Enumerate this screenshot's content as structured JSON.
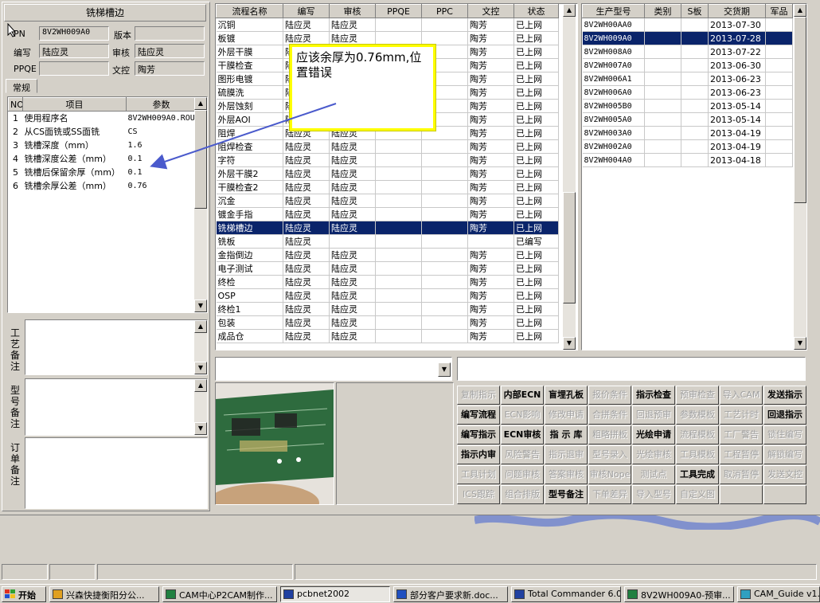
{
  "window": {
    "title": "铣梯槽边"
  },
  "info": {
    "pn_label": "PN",
    "pn_value": "8V2WH009A0",
    "version_label": "版本",
    "version_value": "",
    "writer_label": "编写",
    "writer_value": "陆应灵",
    "reviewer_label": "审核",
    "reviewer_value": "陆应灵",
    "ppqe_label": "PPQE",
    "ppqe_value": "",
    "doc_control_label": "文控",
    "doc_control_value": "陶芳"
  },
  "tabs": {
    "general": "常规"
  },
  "params_table": {
    "headers": [
      "NO",
      "项目",
      "参数"
    ],
    "rows": [
      {
        "no": "1",
        "item": "使用程序名",
        "value": "8V2WH009A0.ROU."
      },
      {
        "no": "2",
        "item": "从CS面铣或SS面铣",
        "value": "CS"
      },
      {
        "no": "3",
        "item": "铣槽深度（mm）",
        "value": "1.6"
      },
      {
        "no": "4",
        "item": "铣槽深度公差（mm）",
        "value": "0.1"
      },
      {
        "no": "5",
        "item": "铣槽后保留余厚（mm）",
        "value": "0.1"
      },
      {
        "no": "6",
        "item": "铣槽余厚公差（mm）",
        "value": "0.76"
      }
    ]
  },
  "notes": {
    "process_label": "工艺备注",
    "model_label": "型号备注",
    "order_label": "订单备注"
  },
  "flow_table": {
    "headers": [
      "流程名称",
      "编写",
      "审核",
      "PPQE",
      "PPC",
      "文控",
      "状态"
    ],
    "selected_index": 15,
    "rows": [
      [
        "沉铜",
        "陆应灵",
        "陆应灵",
        "",
        "",
        "陶芳",
        "已上网"
      ],
      [
        "板镀",
        "陆应灵",
        "陆应灵",
        "",
        "",
        "陶芳",
        "已上网"
      ],
      [
        "外层干膜",
        "陆",
        "",
        "",
        "",
        "陶芳",
        "已上网"
      ],
      [
        "干膜检查",
        "陆",
        "",
        "",
        "",
        "陶芳",
        "已上网"
      ],
      [
        "图形电镀",
        "陆",
        "",
        "",
        "",
        "陶芳",
        "已上网"
      ],
      [
        "硫膜洗",
        "陆",
        "",
        "",
        "",
        "陶芳",
        "已上网"
      ],
      [
        "外层蚀刻",
        "陆",
        "",
        "",
        "",
        "陶芳",
        "已上网"
      ],
      [
        "外层AOI",
        "陆",
        "",
        "",
        "",
        "陶芳",
        "已上网"
      ],
      [
        "阻焊",
        "陆应灵",
        "陆应灵",
        "",
        "",
        "陶芳",
        "已上网"
      ],
      [
        "阻焊检查",
        "陆应灵",
        "陆应灵",
        "",
        "",
        "陶芳",
        "已上网"
      ],
      [
        "字符",
        "陆应灵",
        "陆应灵",
        "",
        "",
        "陶芳",
        "已上网"
      ],
      [
        "外层干膜2",
        "陆应灵",
        "陆应灵",
        "",
        "",
        "陶芳",
        "已上网"
      ],
      [
        "干膜检查2",
        "陆应灵",
        "陆应灵",
        "",
        "",
        "陶芳",
        "已上网"
      ],
      [
        "沉金",
        "陆应灵",
        "陆应灵",
        "",
        "",
        "陶芳",
        "已上网"
      ],
      [
        "镀金手指",
        "陆应灵",
        "陆应灵",
        "",
        "",
        "陶芳",
        "已上网"
      ],
      [
        "铣梯槽边",
        "陆应灵",
        "陆应灵",
        "",
        "",
        "陶芳",
        "已上网"
      ],
      [
        "铣板",
        "陆应灵",
        "",
        "",
        "",
        "",
        "已编写"
      ],
      [
        "金指倒边",
        "陆应灵",
        "陆应灵",
        "",
        "",
        "陶芳",
        "已上网"
      ],
      [
        "电子测试",
        "陆应灵",
        "陆应灵",
        "",
        "",
        "陶芳",
        "已上网"
      ],
      [
        "终检",
        "陆应灵",
        "陆应灵",
        "",
        "",
        "陶芳",
        "已上网"
      ],
      [
        "OSP",
        "陆应灵",
        "陆应灵",
        "",
        "",
        "陶芳",
        "已上网"
      ],
      [
        "终检1",
        "陆应灵",
        "陆应灵",
        "",
        "",
        "陶芳",
        "已上网"
      ],
      [
        "包装",
        "陆应灵",
        "陆应灵",
        "",
        "",
        "陶芳",
        "已上网"
      ],
      [
        "成品仓",
        "陆应灵",
        "陆应灵",
        "",
        "",
        "陶芳",
        "已上网"
      ]
    ]
  },
  "annotation": {
    "text": "应该余厚为0.76mm,位置错误"
  },
  "model_table": {
    "headers": [
      "生产型号",
      "类别",
      "S板",
      "交货期",
      "军品"
    ],
    "selected_index": 1,
    "rows": [
      [
        "8V2WH00AA0",
        "",
        "",
        "2013-07-30",
        ""
      ],
      [
        "8V2WH009A0",
        "",
        "",
        "2013-07-28",
        ""
      ],
      [
        "8V2WH008A0",
        "",
        "",
        "2013-07-22",
        ""
      ],
      [
        "8V2WH007A0",
        "",
        "",
        "2013-06-30",
        ""
      ],
      [
        "8V2WH006A1",
        "",
        "",
        "2013-06-23",
        ""
      ],
      [
        "8V2WH006A0",
        "",
        "",
        "2013-06-23",
        ""
      ],
      [
        "8V2WH005B0",
        "",
        "",
        "2013-05-14",
        ""
      ],
      [
        "8V2WH005A0",
        "",
        "",
        "2013-05-14",
        ""
      ],
      [
        "8V2WH003A0",
        "",
        "",
        "2013-04-19",
        ""
      ],
      [
        "8V2WH002A0",
        "",
        "",
        "2013-04-19",
        ""
      ],
      [
        "8V2WH004A0",
        "",
        "",
        "2013-04-18",
        ""
      ]
    ]
  },
  "buttons": [
    [
      {
        "label": "复制指示",
        "enabled": false
      },
      {
        "label": "内部ECN",
        "enabled": true
      },
      {
        "label": "盲埋孔板",
        "enabled": true
      },
      {
        "label": "报价条件",
        "enabled": false
      },
      {
        "label": "指示检查",
        "enabled": true
      },
      {
        "label": "预审检查",
        "enabled": false
      },
      {
        "label": "导入CAM",
        "enabled": false
      },
      {
        "label": "发送指示",
        "enabled": true
      }
    ],
    [
      {
        "label": "编写流程",
        "enabled": true
      },
      {
        "label": "ECN影响",
        "enabled": false
      },
      {
        "label": "修改申请",
        "enabled": false
      },
      {
        "label": "合拼条件",
        "enabled": false
      },
      {
        "label": "回退预审",
        "enabled": false
      },
      {
        "label": "参数模板",
        "enabled": false
      },
      {
        "label": "工艺计时",
        "enabled": false
      },
      {
        "label": "回退指示",
        "enabled": true
      }
    ],
    [
      {
        "label": "编写指示",
        "enabled": true
      },
      {
        "label": "ECN审核",
        "enabled": true
      },
      {
        "label": "指 示 库",
        "enabled": true
      },
      {
        "label": "粗略拼板",
        "enabled": false
      },
      {
        "label": "光绘申请",
        "enabled": true
      },
      {
        "label": "流程模板",
        "enabled": false
      },
      {
        "label": "工厂警告",
        "enabled": false
      },
      {
        "label": "锁住编写",
        "enabled": false
      }
    ],
    [
      {
        "label": "指示内审",
        "enabled": true
      },
      {
        "label": "风险警告",
        "enabled": false
      },
      {
        "label": "指示退审",
        "enabled": false
      },
      {
        "label": "型号录入",
        "enabled": false
      },
      {
        "label": "光绘审核",
        "enabled": false
      },
      {
        "label": "工具模板",
        "enabled": false
      },
      {
        "label": "工程暂停",
        "enabled": false
      },
      {
        "label": "解锁编写",
        "enabled": false
      }
    ],
    [
      {
        "label": "工具计划",
        "enabled": false
      },
      {
        "label": "问题审核",
        "enabled": false
      },
      {
        "label": "答案审核",
        "enabled": false
      },
      {
        "label": "审核Nope",
        "enabled": false
      },
      {
        "label": "测试点",
        "enabled": false
      },
      {
        "label": "工具完成",
        "enabled": true
      },
      {
        "label": "取消暂停",
        "enabled": false
      },
      {
        "label": "发送文控",
        "enabled": false
      }
    ],
    [
      {
        "label": "ICS跟踪",
        "enabled": false
      },
      {
        "label": "组合排版",
        "enabled": false
      },
      {
        "label": "型号备注",
        "enabled": true
      },
      {
        "label": "下单差异",
        "enabled": false
      },
      {
        "label": "导入型号",
        "enabled": false
      },
      {
        "label": "自定义图",
        "enabled": false
      },
      {
        "label": "",
        "enabled": false
      },
      {
        "label": "",
        "enabled": false
      }
    ]
  ],
  "taskbar": {
    "start": "开始",
    "tasks": [
      {
        "label": "兴森快捷衡阳分公...",
        "icon": "star-icon",
        "active": false
      },
      {
        "label": "CAM中心P2CAM制作...",
        "icon": "excel-icon",
        "active": false
      },
      {
        "label": "pcbnet2002",
        "icon": "app-icon",
        "active": true
      },
      {
        "label": "部分客户要求新.doc...",
        "icon": "word-icon",
        "active": false
      },
      {
        "label": "Total Commander 6.0...",
        "icon": "floppy-icon",
        "active": false
      },
      {
        "label": "8V2WH009A0-预审...",
        "icon": "excel-icon",
        "active": false
      },
      {
        "label": "CAM_Guide v1.6",
        "icon": "cam-icon",
        "active": false
      }
    ]
  },
  "colors": {
    "selection": "#0a246a",
    "annotation_border": "#ffff00",
    "arrow": "#4a5acc",
    "face": "#d4d0c8"
  }
}
